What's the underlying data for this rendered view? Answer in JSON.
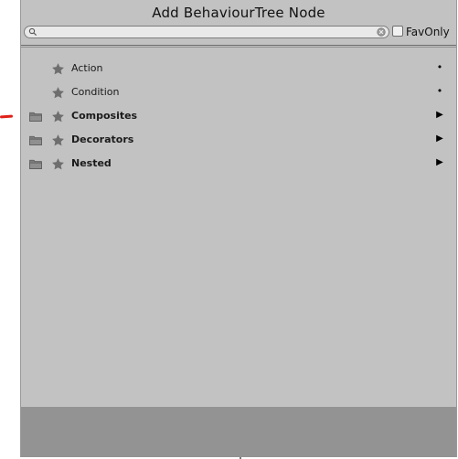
{
  "window": {
    "title": "Add BehaviourTree Node"
  },
  "search": {
    "value": "",
    "placeholder": ""
  },
  "fav_only": {
    "label": "FavOnly",
    "checked": false
  },
  "items": [
    {
      "label": "Action",
      "kind": "leaf",
      "folder": false,
      "bold": false,
      "end_glyph": "•",
      "star_icon": "star-icon"
    },
    {
      "label": "Condition",
      "kind": "leaf",
      "folder": false,
      "bold": false,
      "end_glyph": "•",
      "star_icon": "star-icon"
    },
    {
      "label": "Composites",
      "kind": "category",
      "folder": true,
      "bold": true,
      "end_glyph": "▶",
      "star_icon": "star-icon"
    },
    {
      "label": "Decorators",
      "kind": "category",
      "folder": true,
      "bold": true,
      "end_glyph": "▶",
      "star_icon": "star-icon"
    },
    {
      "label": "Nested",
      "kind": "category",
      "folder": true,
      "bold": true,
      "end_glyph": "▶",
      "star_icon": "star-icon"
    }
  ],
  "colors": {
    "panel_bg": "#c2c2c2",
    "footer_bg": "#939393",
    "marker": "#e0201a",
    "icon_gray": "#6e6e6e"
  }
}
